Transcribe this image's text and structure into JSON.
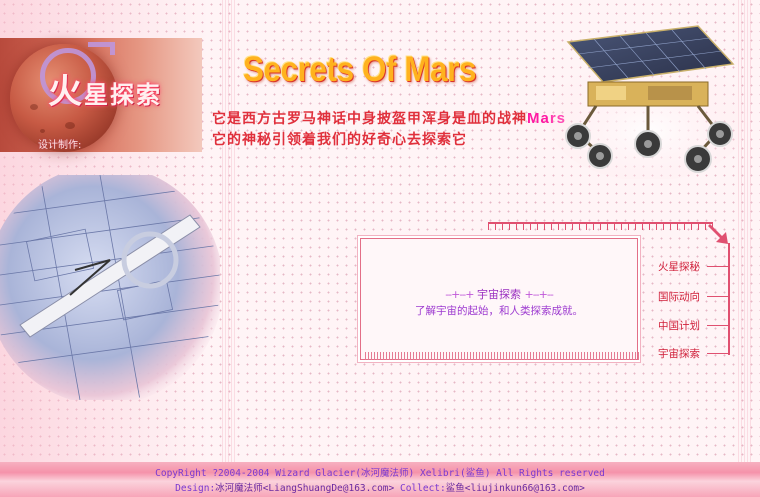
{
  "header": {
    "logo_title_big": "火",
    "logo_title_rest": "星探索",
    "designer_label": "设计制作:",
    "headline": "Secrets Of Mars",
    "tagline_line1_prefix": "它是西方古罗马神话中身披盔甲浑身是血的战神",
    "tagline_line1_highlight": "Mars",
    "tagline_line2": "它的神秘引领着我们的好奇心去探索它"
  },
  "panel": {
    "heading_deco_left": "--+--+",
    "heading": "宇宙探索",
    "heading_deco_right": "+--+--",
    "text": "了解宇宙的起始，和人类探索成就。"
  },
  "nav": {
    "items": [
      {
        "label": "火星探秘"
      },
      {
        "label": "国际动向"
      },
      {
        "label": "中国计划"
      },
      {
        "label": "宇宙探索"
      }
    ]
  },
  "footer": {
    "copyright": "CopyRight ?2004-2004 Wizard Glacier(冰河魔法师) Xelibri(鲨鱼) All Rights reserved",
    "design_label": "Design:",
    "designer_name": "冰河魔法师",
    "designer_email": "<LiangShuangDe@163.com>",
    "collect_label": " Collect:",
    "collector_name": "鲨鱼",
    "collector_email": "<liujinkun66@163.com>"
  },
  "colors": {
    "accent_red": "#e05070",
    "headline_orange": "#ffb21e",
    "footer_text": "#7a3ad0",
    "panel_text": "#9d3ad0"
  }
}
